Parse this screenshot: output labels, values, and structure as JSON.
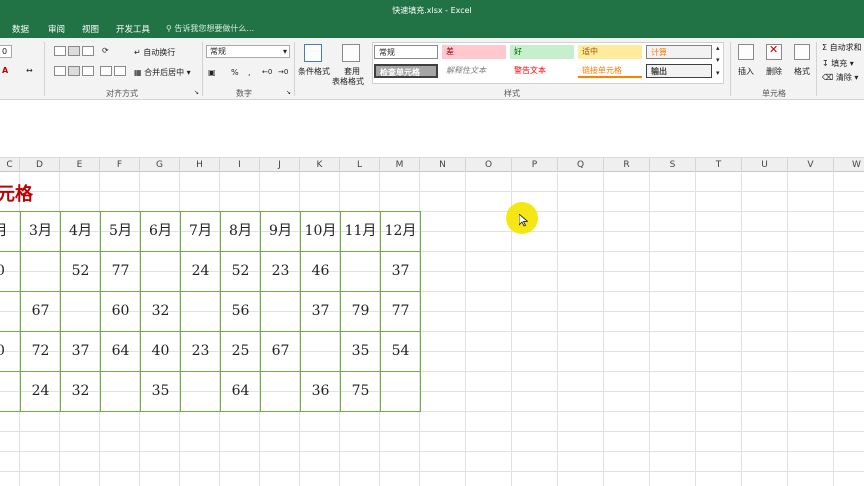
{
  "window": {
    "title": "快速填充.xlsx - Excel"
  },
  "tabs": [
    "数据",
    "审阅",
    "视图",
    "开发工具"
  ],
  "tell_me": "告诉我您想要做什么...",
  "ribbon": {
    "font_size": "0",
    "wrap_text": "自动换行",
    "merge_center": "合并后居中",
    "number_format": "常规",
    "percent": "%",
    "comma": ",",
    "conditional_format": "条件格式",
    "format_table_1": "套用",
    "format_table_2": "表格格式",
    "styles": [
      "常规",
      "差",
      "好",
      "适中",
      "计算",
      "检查单元格",
      "解释性文本",
      "警告文本",
      "链接单元格",
      "输出"
    ],
    "insert": "插入",
    "delete": "删除",
    "format": "格式",
    "autosum": "自动求和",
    "fill": "填充",
    "clear": "清除",
    "groups": {
      "alignment": "对齐方式",
      "number": "数字",
      "styles": "样式",
      "cells": "单元格"
    }
  },
  "columns": [
    "C",
    "D",
    "E",
    "F",
    "G",
    "H",
    "I",
    "J",
    "K",
    "L",
    "M",
    "N",
    "O",
    "P",
    "Q",
    "R",
    "S",
    "T",
    "U",
    "V",
    "W"
  ],
  "sheet": {
    "headline": "元格",
    "months": [
      "月",
      "3月",
      "4月",
      "5月",
      "6月",
      "7月",
      "8月",
      "9月",
      "10月",
      "11月",
      "12月"
    ],
    "rows": [
      [
        "0",
        "",
        "52",
        "77",
        "",
        "24",
        "52",
        "23",
        "46",
        "",
        "37"
      ],
      [
        "",
        "67",
        "",
        "60",
        "32",
        "",
        "56",
        "",
        "37",
        "79",
        "77"
      ],
      [
        "0",
        "72",
        "37",
        "64",
        "40",
        "23",
        "25",
        "67",
        "",
        "35",
        "54"
      ],
      [
        "",
        "24",
        "32",
        "",
        "35",
        "",
        "64",
        "",
        "36",
        "75",
        ""
      ]
    ]
  },
  "colors": {
    "excel_green": "#217346",
    "border_green": "#70ad47",
    "headline_red": "#c00000",
    "cursor_yellow": "#f5e600"
  }
}
